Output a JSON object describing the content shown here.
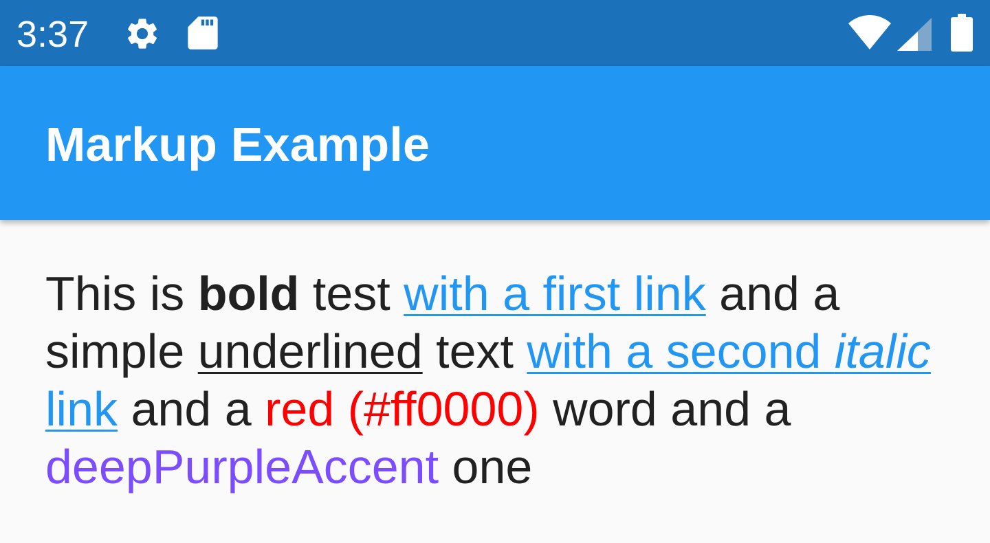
{
  "status_bar": {
    "time": "3:37",
    "background": "#1b72bb",
    "icons": [
      "gear-icon",
      "sd-card-icon",
      "wifi-icon",
      "signal-icon",
      "battery-icon"
    ]
  },
  "app_bar": {
    "title": "Markup Example",
    "background": "#2196f3"
  },
  "content": {
    "seg_1": "This is ",
    "seg_bold": "bold",
    "seg_2": " test ",
    "link_1": "with a first link",
    "seg_3": " and a simple ",
    "seg_underlined": "underlined",
    "seg_4": " text ",
    "link_2_part_1": "with a second ",
    "link_2_italic": "italic",
    "link_2_part_2": " link",
    "seg_5": " and a ",
    "seg_red": "red (#ff0000)",
    "seg_6": " word and a ",
    "seg_purple": "deepPurpleAccent",
    "seg_7": " one",
    "colors": {
      "text": "#212121",
      "link": "#2196f3",
      "red": "#ff0000",
      "deep_purple_accent": "#7c4dff"
    }
  }
}
